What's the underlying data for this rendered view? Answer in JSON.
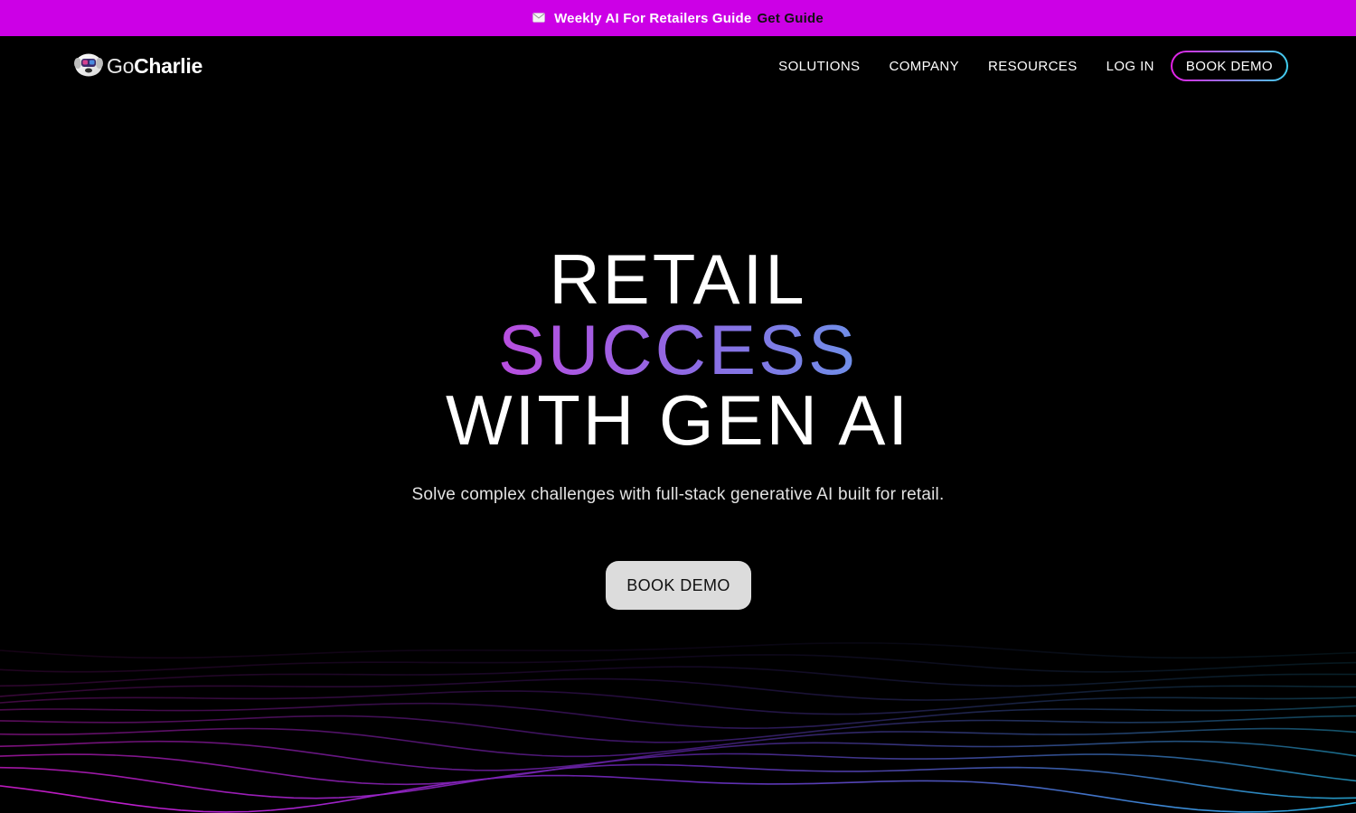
{
  "announcement": {
    "icon": "mail-icon",
    "text": "Weekly AI For Retailers Guide",
    "link_label": "Get Guide",
    "background": "#cc00e6"
  },
  "brand": {
    "name_part_1": "Go",
    "name_part_2": "Charlie",
    "logo_icon": "gocharlie-mascot-icon"
  },
  "nav": {
    "items": [
      {
        "label": "SOLUTIONS"
      },
      {
        "label": "COMPANY"
      },
      {
        "label": "RESOURCES"
      },
      {
        "label": "LOG IN"
      }
    ],
    "cta_label": "BOOK DEMO",
    "cta_gradient": [
      "#e51ee6",
      "#3fd0ef"
    ]
  },
  "hero": {
    "line1": "RETAIL",
    "line2": "SUCCESS",
    "line3": "WITH GEN AI",
    "subtitle": "Solve complex challenges with full-stack generative AI built for retail.",
    "cta_label": "BOOK DEMO",
    "accent_gradient": [
      "#b94ee0",
      "#6f8fe8"
    ]
  },
  "decor": {
    "wave_colors": [
      "#e01ee0",
      "#8a2fd8",
      "#2bb8ea"
    ]
  }
}
